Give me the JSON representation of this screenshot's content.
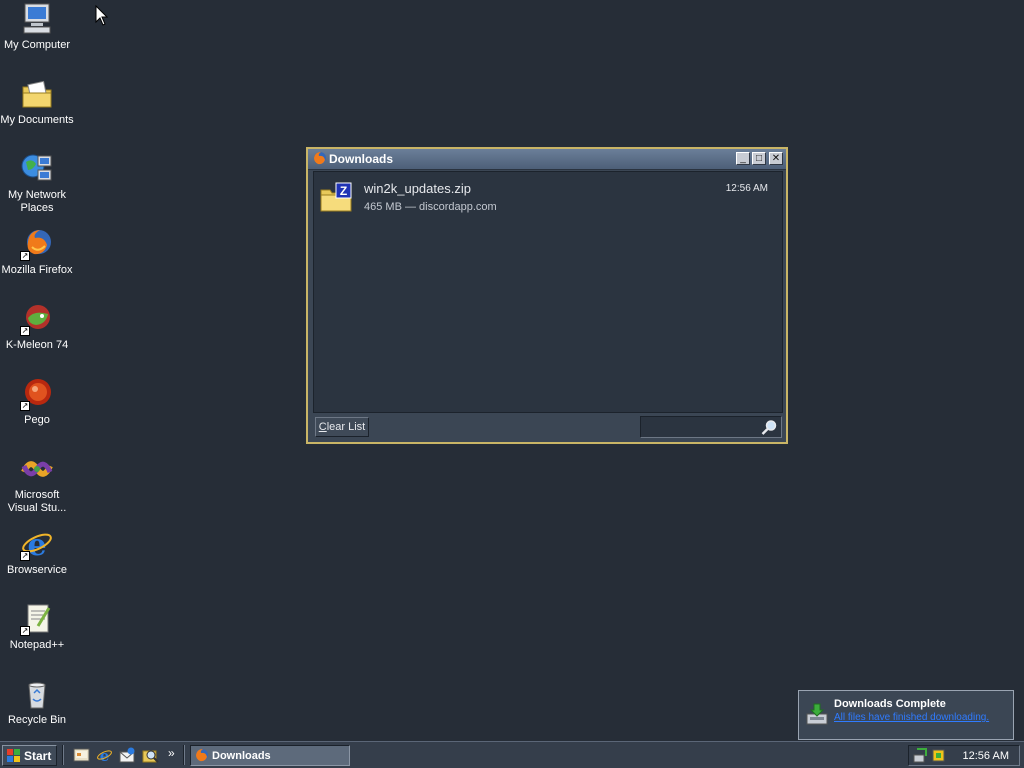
{
  "desktop": {
    "icons": [
      {
        "label": "My Computer"
      },
      {
        "label": "My Documents"
      },
      {
        "label": "My Network Places"
      },
      {
        "label": "Mozilla Firefox"
      },
      {
        "label": "K-Meleon 74"
      },
      {
        "label": "Pego"
      },
      {
        "label": "Microsoft Visual Stu..."
      },
      {
        "label": "Browservice"
      },
      {
        "label": "Notepad++"
      },
      {
        "label": "Recycle Bin"
      }
    ]
  },
  "downloads_window": {
    "title": "Downloads",
    "items": [
      {
        "filename": "win2k_updates.zip",
        "meta": "465 MB — discordapp.com",
        "time": "12:56 AM",
        "file_badge": "Z"
      }
    ],
    "clear_button": {
      "label_first": "C",
      "label_rest": "lear List"
    },
    "search": {
      "placeholder": "",
      "value": ""
    }
  },
  "notification": {
    "title": "Downloads Complete",
    "message": "All files have finished downloading."
  },
  "taskbar": {
    "start_label": "Start",
    "chevron": "»",
    "task_label": "Downloads",
    "clock": "12:56 AM"
  },
  "colors": {
    "desktop": "#262d37",
    "window_border": "#c9b566",
    "link": "#2f7bff"
  }
}
